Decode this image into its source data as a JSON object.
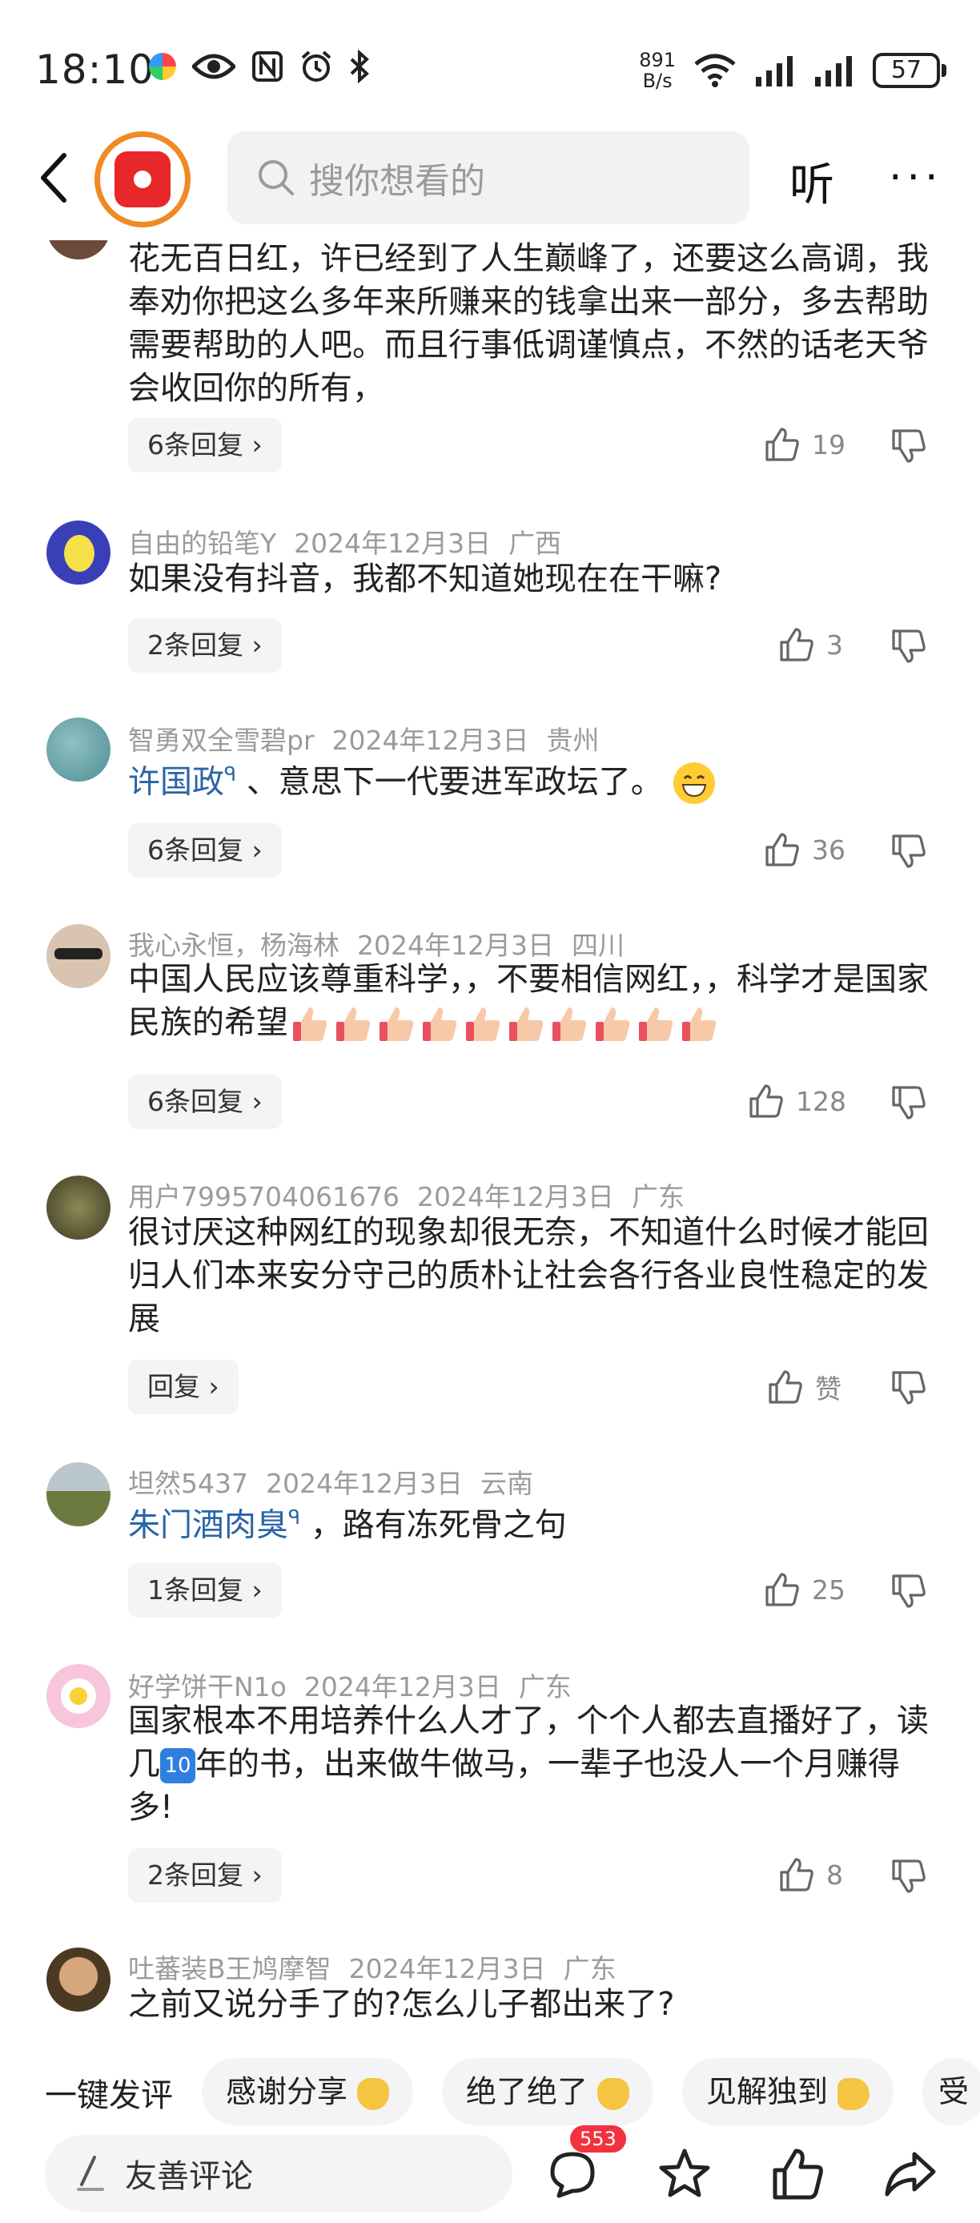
{
  "status_bar": {
    "time": "18:10",
    "speed_value": "891",
    "speed_unit": "B/s",
    "battery": "57"
  },
  "header": {
    "search_placeholder": "搜你想看的",
    "listen": "听",
    "more": "···"
  },
  "comments": [
    {
      "text": "花无百日红，许已经到了人生巅峰了，还要这么高调，我奉劝你把这么多年来所赚来的钱拿出来一部分，多去帮助需要帮助的人吧。而且行事低调谨慎点，不然的话老天爷会收回你的所有，",
      "replies": "6条回复 ›",
      "likes": "19"
    },
    {
      "user": "自由的铅笔Y",
      "date": "2024年12月3日",
      "region": "广西",
      "text": "如果没有抖音，我都不知道她现在在干嘛?",
      "replies": "2条回复 ›",
      "likes": "3"
    },
    {
      "user": "智勇双全雪碧pr",
      "date": "2024年12月3日",
      "region": "贵州",
      "mention": "许国政",
      "text": "、意思下一代要进军政坛了。",
      "replies": "6条回复 ›",
      "likes": "36"
    },
    {
      "user": "我心永恒，杨海林",
      "date": "2024年12月3日",
      "region": "四川",
      "text": "中国人民应该尊重科学，，不要相信网红，，科学才是国家民族的希望",
      "replies": "6条回复 ›",
      "likes": "128"
    },
    {
      "user": "用户7995704061676",
      "date": "2024年12月3日",
      "region": "广东",
      "text": "很讨厌这种网红的现象却很无奈，不知道什么时候才能回归人们本来安分守己的质朴让社会各行各业良性稳定的发展",
      "replies": "回复 ›",
      "likes": "赞"
    },
    {
      "user": "坦然5437",
      "date": "2024年12月3日",
      "region": "云南",
      "mention": "朱门酒肉臭",
      "text": "，路有冻死骨之句",
      "replies": "1条回复 ›",
      "likes": "25"
    },
    {
      "user": "好学饼干N1o",
      "date": "2024年12月3日",
      "region": "广东",
      "text_a": "国家根本不用培养什么人才了，个个人都去直播好了，读几",
      "emoji_ten": "10",
      "text_b": "年的书，出来做牛做马，一辈子也没人一个月赚得多!",
      "replies": "2条回复 ›",
      "likes": "8"
    },
    {
      "user": "吐蕃装B王鸠摩智",
      "date": "2024年12月3日",
      "region": "广东",
      "text": "之前又说分手了的?怎么儿子都出来了?"
    }
  ],
  "quick_comments": {
    "label": "一键发评",
    "chips": [
      "感谢分享",
      "绝了绝了",
      "见解独到",
      "受"
    ]
  },
  "bottom_bar": {
    "input_placeholder": "友善评论",
    "comment_count": "553"
  },
  "colors": {
    "accent_red": "#e8272b",
    "mention_blue": "#2a64a8",
    "badge_red": "#f2323f"
  }
}
